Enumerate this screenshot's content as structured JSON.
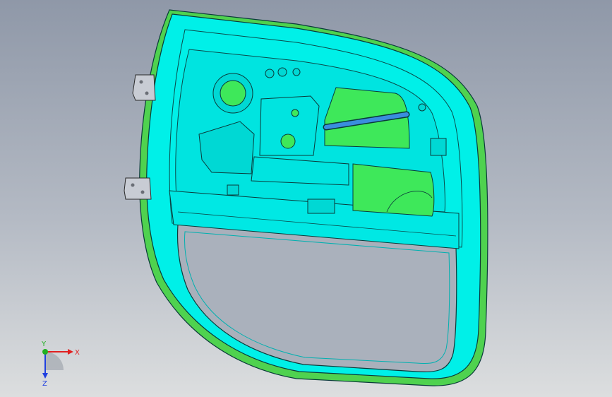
{
  "viewport": {
    "background_top": "#8f98a8",
    "background_bottom": "#dcdedf"
  },
  "model": {
    "colors": {
      "panel": "#00f0e8",
      "panel_dark": "#00b8b8",
      "edge": "#0a3a3a",
      "flange": "#4fd24f",
      "insert": "#3ee85a",
      "rod": "#3a8ede",
      "hinge": "#c8ccd4"
    }
  },
  "triad": {
    "x_label": "X",
    "y_label": "Y",
    "z_label": "Z",
    "x_color": "#e02020",
    "y_color": "#20b020",
    "z_color": "#2040e0"
  }
}
